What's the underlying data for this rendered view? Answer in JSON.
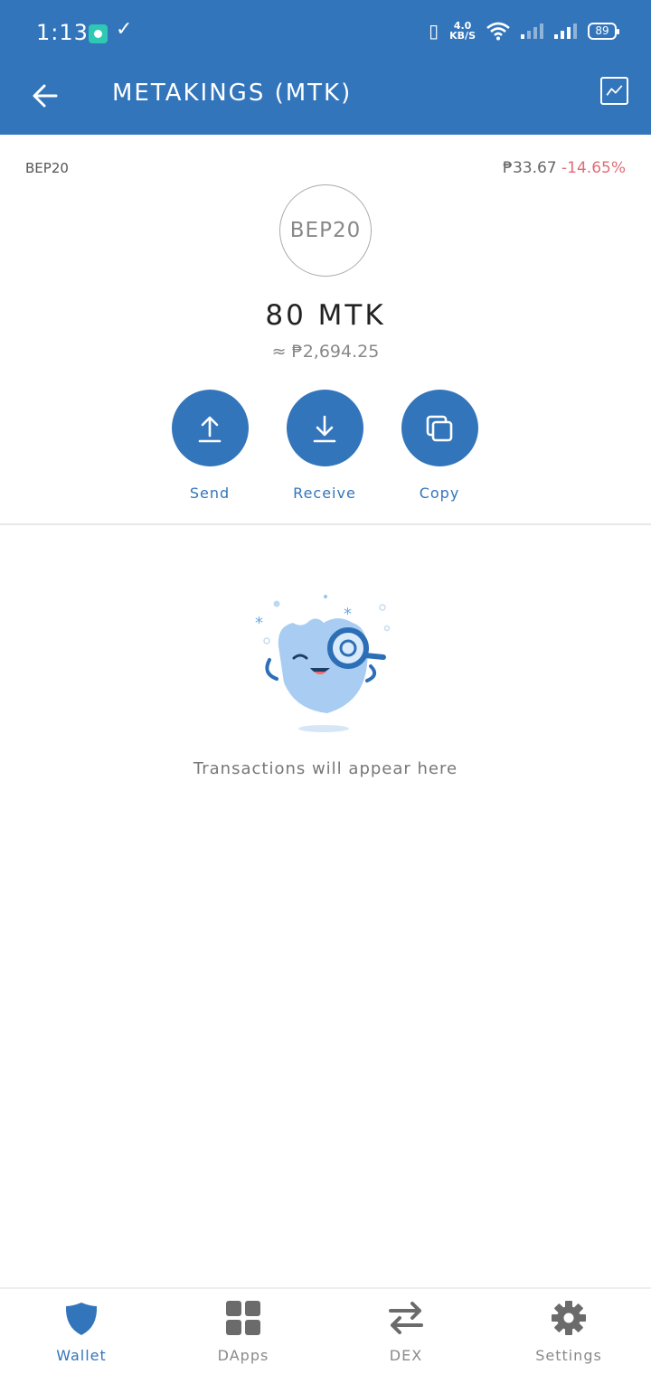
{
  "status_bar": {
    "time": "1:13",
    "check_icon": "check-icon",
    "net_speed_value": "4.0",
    "net_speed_unit": "KB/S",
    "battery": "89"
  },
  "app_bar": {
    "title": "METAKINGS (MTK)",
    "back_icon": "arrow-left-icon",
    "chart_icon": "chart-line-icon"
  },
  "token": {
    "standard": "BEP20",
    "logo_text": "BEP20",
    "price": "₱33.67",
    "change": "-14.65%",
    "balance": "80 MTK",
    "fiat_value": "≈ ₱2,694.25"
  },
  "actions": [
    {
      "label": "Send",
      "icon": "arrow-up-icon"
    },
    {
      "label": "Receive",
      "icon": "arrow-down-icon"
    },
    {
      "label": "Copy",
      "icon": "copy-icon"
    }
  ],
  "empty_state": {
    "message": "Transactions will appear here",
    "illustration": "search-mascot-illustration"
  },
  "bottom_nav": [
    {
      "label": "Wallet",
      "icon": "shield-icon",
      "active": true
    },
    {
      "label": "DApps",
      "icon": "grid-icon",
      "active": false
    },
    {
      "label": "DEX",
      "icon": "swap-icon",
      "active": false
    },
    {
      "label": "Settings",
      "icon": "gear-icon",
      "active": false
    }
  ],
  "colors": {
    "primary": "#3375bb",
    "negative": "#e06c75",
    "muted": "#8a8a8a"
  }
}
